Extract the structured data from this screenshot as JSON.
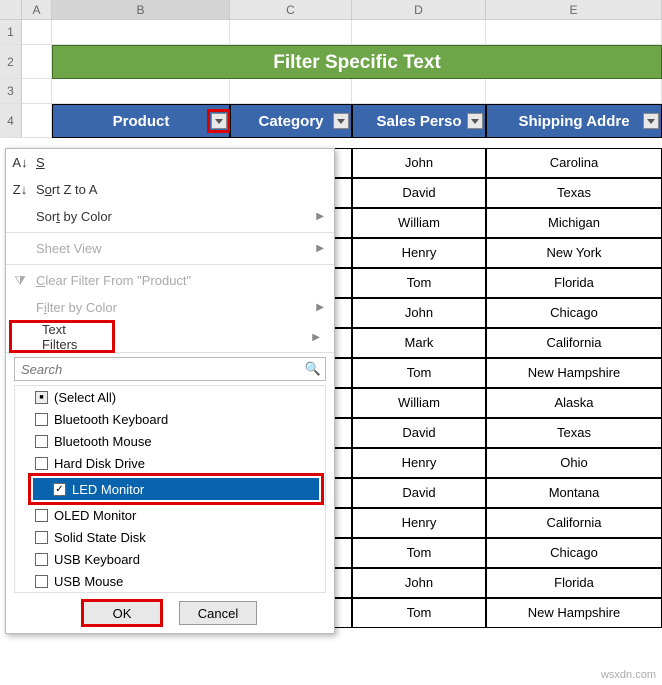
{
  "columns": [
    "A",
    "B",
    "C",
    "D",
    "E"
  ],
  "title": "Filter Specific Text",
  "headers": {
    "product": "Product",
    "category": "Category",
    "sales": "Sales Perso",
    "shipping": "Shipping Addre"
  },
  "rows": [
    {
      "sales": "John",
      "ship": "Carolina"
    },
    {
      "sales": "David",
      "ship": "Texas"
    },
    {
      "sales": "William",
      "ship": "Michigan"
    },
    {
      "sales": "Henry",
      "ship": "New York"
    },
    {
      "sales": "Tom",
      "ship": "Florida"
    },
    {
      "sales": "John",
      "ship": "Chicago"
    },
    {
      "sales": "Mark",
      "ship": "California"
    },
    {
      "sales": "Tom",
      "ship": "New Hampshire"
    },
    {
      "sales": "William",
      "ship": "Alaska"
    },
    {
      "sales": "David",
      "ship": "Texas"
    },
    {
      "sales": "Henry",
      "ship": "Ohio"
    },
    {
      "sales": "David",
      "ship": "Montana"
    },
    {
      "sales": "Henry",
      "ship": "California"
    },
    {
      "sales": "Tom",
      "ship": "Chicago"
    },
    {
      "sales": "John",
      "ship": "Florida"
    },
    {
      "sales": "Tom",
      "ship": "New Hampshire"
    }
  ],
  "dropdown": {
    "sort_az": "Sort A to Z",
    "sort_za": "Sort Z to A",
    "sort_color": "Sort by Color",
    "sheet_view": "Sheet View",
    "clear_filter": "Clear Filter From \"Product\"",
    "filter_color": "Filter by Color",
    "text_filters": "Text Filters",
    "search_ph": "Search",
    "items": [
      {
        "label": "(Select All)",
        "checked": "tri"
      },
      {
        "label": "Bluetooth Keyboard",
        "checked": false
      },
      {
        "label": "Bluetooth Mouse",
        "checked": false
      },
      {
        "label": "Hard Disk Drive",
        "checked": false
      },
      {
        "label": "LED Monitor",
        "checked": true,
        "sel": true
      },
      {
        "label": "OLED Monitor",
        "checked": false
      },
      {
        "label": "Solid State Disk",
        "checked": false
      },
      {
        "label": "USB Keyboard",
        "checked": false
      },
      {
        "label": "USB Mouse",
        "checked": false
      }
    ],
    "ok": "OK",
    "cancel": "Cancel"
  },
  "watermark": "wsxdn.com"
}
